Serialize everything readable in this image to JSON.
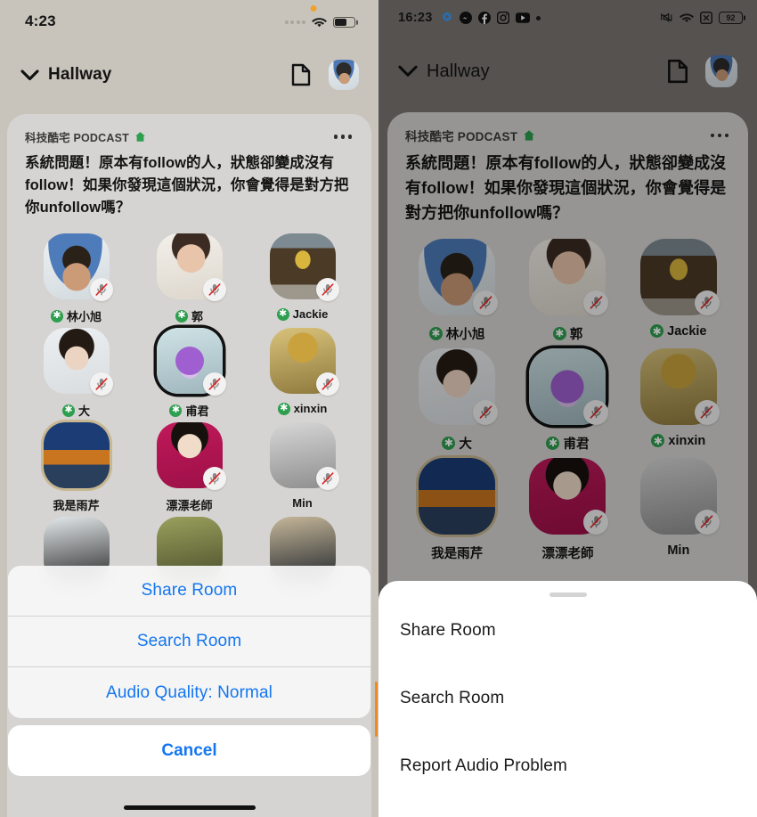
{
  "ios": {
    "platform": "iOS",
    "status_bar": {
      "time": "4:23",
      "mic_indicator": "orange-dot",
      "cellular": "cellular-dots-icon",
      "wifi": "wifi-icon",
      "battery": "battery-icon"
    },
    "header": {
      "chevron": "chevron-down-icon",
      "room_label": "Hallway",
      "doc_icon": "document-icon",
      "avatar": "profile-avatar"
    },
    "room": {
      "club_name": "科技酷宅 PODCAST",
      "club_house_icon": "house-icon",
      "more_icon": "more-options-icon",
      "title": "系統問題！原本有follow的人，狀態卻變成沒有follow！如果你發現這個狀況，你會覺得是對方把你unfollow嗎？"
    },
    "participants": [
      {
        "name": "林小旭",
        "moderator": true,
        "muted": true,
        "avatar": "a-lin"
      },
      {
        "name": "郭",
        "moderator": true,
        "muted": true,
        "avatar": "a-guo"
      },
      {
        "name": "Jackie",
        "moderator": true,
        "muted": true,
        "avatar": "a-jack"
      },
      {
        "name": "大",
        "moderator": true,
        "muted": true,
        "avatar": "a-da"
      },
      {
        "name": "甫君",
        "moderator": true,
        "muted": true,
        "avatar": "a-fujun"
      },
      {
        "name": "xinxin",
        "moderator": true,
        "muted": true,
        "avatar": "a-xin"
      },
      {
        "name": "我是雨芹",
        "moderator": false,
        "muted": false,
        "avatar": "a-yuqin"
      },
      {
        "name": "漂漂老師",
        "moderator": false,
        "muted": true,
        "avatar": "a-piao"
      },
      {
        "name": "Min",
        "moderator": false,
        "muted": true,
        "avatar": "a-min"
      }
    ],
    "action_sheet": {
      "options": [
        "Share Room",
        "Search Room",
        "Audio Quality: Normal"
      ],
      "cancel": "Cancel"
    },
    "accent_color": "#1476f0",
    "background_color": "#c8c4bc",
    "card_color": "#d5d4d2"
  },
  "android": {
    "platform": "Android",
    "status_bar": {
      "time": "16:23",
      "left_icons": [
        "gear-icon",
        "messenger-icon",
        "facebook-icon",
        "instagram-icon",
        "youtube-icon",
        "dot-icon"
      ],
      "vibrate": "vibrate-icon",
      "wifi": "wifi-icon",
      "no_sim": "no-sim-icon",
      "battery_level": "92"
    },
    "header": {
      "chevron": "chevron-down-icon",
      "room_label": "Hallway",
      "doc_icon": "document-icon",
      "avatar": "profile-avatar"
    },
    "room": {
      "club_name": "科技酷宅 PODCAST",
      "club_house_icon": "house-icon",
      "more_icon": "more-options-icon",
      "title": "系統問題！原本有follow的人，狀態卻變成沒有follow！如果你發現這個狀況，你會覺得是對方把你unfollow嗎？"
    },
    "participants": [
      {
        "name": "林小旭",
        "moderator": true,
        "muted": true,
        "avatar": "a-lin"
      },
      {
        "name": "郭",
        "moderator": true,
        "muted": true,
        "avatar": "a-guo"
      },
      {
        "name": "Jackie",
        "moderator": true,
        "muted": true,
        "avatar": "a-jack"
      },
      {
        "name": "大",
        "moderator": true,
        "muted": true,
        "avatar": "a-da"
      },
      {
        "name": "甫君",
        "moderator": true,
        "muted": true,
        "avatar": "a-fujun"
      },
      {
        "name": "xinxin",
        "moderator": true,
        "muted": true,
        "avatar": "a-xin"
      },
      {
        "name": "我是雨芹",
        "moderator": false,
        "muted": false,
        "avatar": "a-yuqin"
      },
      {
        "name": "漂漂老師",
        "moderator": false,
        "muted": true,
        "avatar": "a-piao"
      },
      {
        "name": "Min",
        "moderator": false,
        "muted": true,
        "avatar": "a-min"
      }
    ],
    "bottom_sheet": {
      "handle": "drag-handle",
      "options": [
        "Share Room",
        "Search Room",
        "Report Audio Problem"
      ]
    },
    "background_color": "#7a7672",
    "card_color": "#d7d6d4"
  }
}
